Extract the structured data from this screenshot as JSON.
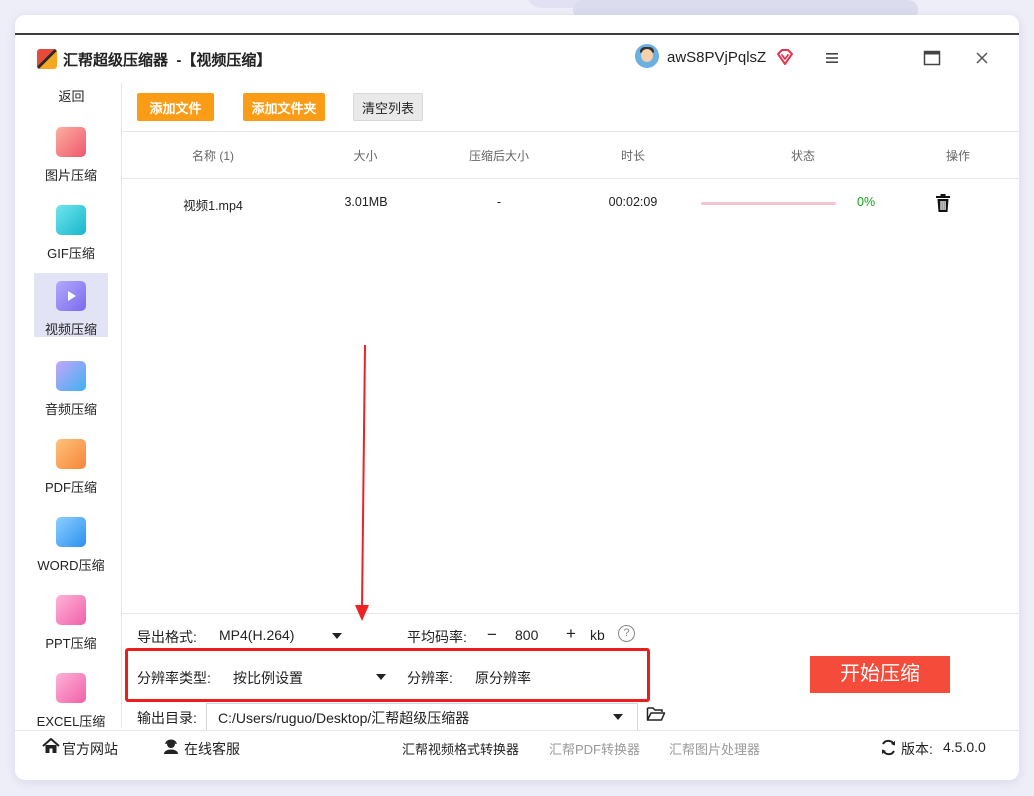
{
  "app": {
    "title": "汇帮超级压缩器",
    "subtitle": "-【视频压缩】",
    "username": "awS8PVjPqlsZ"
  },
  "sidebar": {
    "back_label": "返回",
    "items": [
      {
        "label": "图片压缩",
        "color": "#f56c7a"
      },
      {
        "label": "GIF压缩",
        "color": "#22c4d3"
      },
      {
        "label": "视频压缩",
        "color": "#8b7cf0"
      },
      {
        "label": "音频压缩",
        "color": "#4aa3f0"
      },
      {
        "label": "PDF压缩",
        "color": "#f4933c"
      },
      {
        "label": "WORD压缩",
        "color": "#3a9bf4"
      },
      {
        "label": "PPT压缩",
        "color": "#f471b1"
      },
      {
        "label": "EXCEL压缩",
        "color": "#f471b1"
      }
    ],
    "active_index": 2
  },
  "toolbar": {
    "add_file": "添加文件",
    "add_folder": "添加文件夹",
    "clear_list": "清空列表"
  },
  "table": {
    "headers": [
      "名称 (1)",
      "大小",
      "压缩后大小",
      "时长",
      "状态",
      "操作"
    ],
    "rows": [
      {
        "name": "视频1.mp4",
        "size": "3.01MB",
        "compressed": "-",
        "duration": "00:02:09",
        "progress": 0,
        "percent": "0%"
      }
    ]
  },
  "settings": {
    "format_label": "导出格式:",
    "format_value": "MP4(H.264)",
    "bitrate_label": "平均码率:",
    "bitrate_minus": "−",
    "bitrate_value": "800",
    "bitrate_plus": "+",
    "bitrate_unit": "kb",
    "help_glyph": "?",
    "res_type_label": "分辨率类型:",
    "res_type_value": "按比例设置",
    "res_label": "分辨率:",
    "res_value": "原分辨率",
    "output_label": "输出目录:",
    "output_path": "C:/Users/ruguo/Desktop/汇帮超级压缩器",
    "start_button": "开始压缩"
  },
  "footer": {
    "website": "官方网站",
    "support": "在线客服",
    "link1": "汇帮视频格式转换器",
    "link2": "汇帮PDF转换器",
    "link3": "汇帮图片处理器",
    "version_label": "版本:",
    "version": "4.5.0.0"
  },
  "colors": {
    "accent_orange": "#fb9c16",
    "start_red": "#f54b3a",
    "highlight_red": "#ee1c1c",
    "success_green": "#14a31b"
  }
}
